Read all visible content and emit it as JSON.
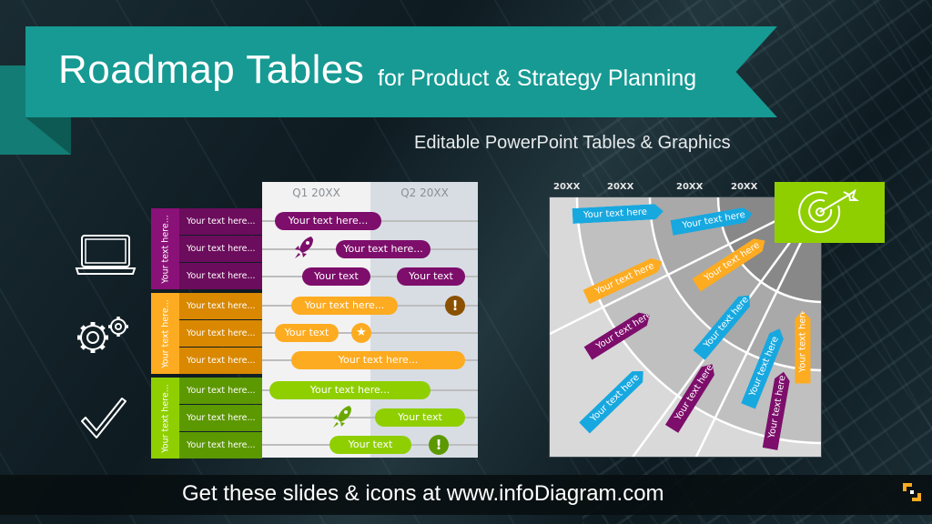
{
  "header": {
    "title": "Roadmap Tables",
    "title_suffix": "for Product & Strategy Planning",
    "subtitle": "Editable PowerPoint Tables & Graphics"
  },
  "colors": {
    "teal": "#169a93",
    "purple": "#7d0e6b",
    "orange": "#fdab20",
    "green": "#8fcf00",
    "blue": "#17a8e0"
  },
  "side_icons": [
    "laptop-icon",
    "gears-icon",
    "checkmark-icon"
  ],
  "roadmap_table": {
    "quarters": [
      "Q1 20XX",
      "Q2 20XX"
    ],
    "groups": [
      {
        "label": "Your text here...",
        "color": "purple",
        "rows": [
          {
            "label": "Your text here...",
            "bars": [
              "Your text here..."
            ]
          },
          {
            "label": "Your text here...",
            "bars": [
              "Your text here..."
            ],
            "icon": "rocket-icon"
          },
          {
            "label": "Your text here...",
            "bars": [
              "Your text",
              "Your text"
            ]
          }
        ]
      },
      {
        "label": "Your text here...",
        "color": "orange",
        "rows": [
          {
            "label": "Your text here...",
            "bars": [
              "Your text here..."
            ],
            "icon": "exclamation-icon"
          },
          {
            "label": "Your text here...",
            "bars": [
              "Your text"
            ],
            "icon": "star-icon"
          },
          {
            "label": "Your text here...",
            "bars": [
              "Your text here..."
            ]
          }
        ]
      },
      {
        "label": "Your text here...",
        "color": "green",
        "rows": [
          {
            "label": "Your text here...",
            "bars": [
              "Your text here..."
            ]
          },
          {
            "label": "Your text here...",
            "bars": [
              "Your text"
            ],
            "icon": "rocket-icon"
          },
          {
            "label": "Your text here...",
            "bars": [
              "Your text"
            ],
            "icon": "exclamation-icon"
          }
        ]
      }
    ],
    "badge_glyphs": {
      "exclamation": "!",
      "star": "★"
    }
  },
  "radial_diagram": {
    "years": [
      "20XX",
      "20XX",
      "20XX",
      "20XX"
    ],
    "tags": [
      {
        "text": "Your text here",
        "color": "blue"
      },
      {
        "text": "Your text here",
        "color": "blue"
      },
      {
        "text": "Your text here",
        "color": "orange"
      },
      {
        "text": "Your text here",
        "color": "orange"
      },
      {
        "text": "Your text here",
        "color": "purple"
      },
      {
        "text": "Your text here",
        "color": "blue"
      },
      {
        "text": "Your text here",
        "color": "blue"
      },
      {
        "text": "Your text here",
        "color": "orange"
      },
      {
        "text": "Your text here",
        "color": "blue"
      },
      {
        "text": "Your text here",
        "color": "purple"
      },
      {
        "text": "Your text here",
        "color": "purple"
      }
    ],
    "target_icon": "target-arrow-icon"
  },
  "footer": {
    "text": "Get these slides & icons at www.infoDiagram.com",
    "logo": "infodiagram-logo"
  }
}
